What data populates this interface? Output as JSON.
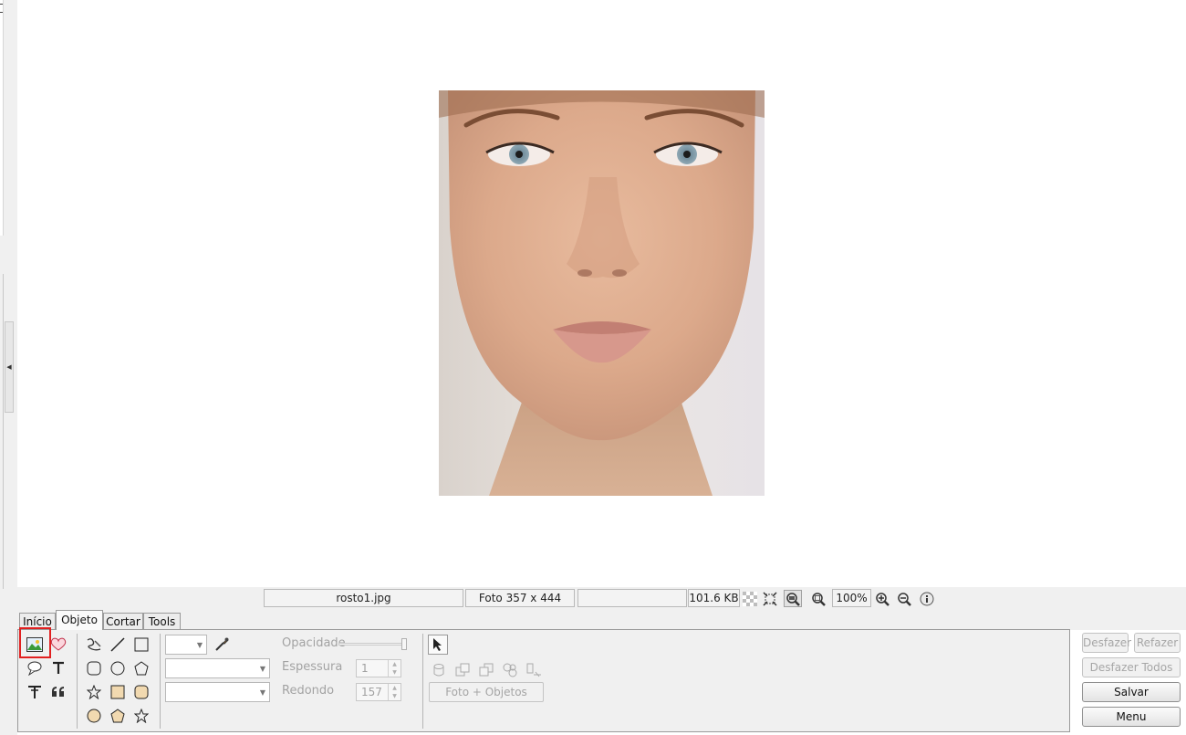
{
  "statusbar": {
    "filename": "rosto1.jpg",
    "photo_size": "Foto 357 x 444",
    "empty_field": "",
    "file_size": "101.6 KB",
    "zoom": "100%"
  },
  "tabs": [
    "Início",
    "Objeto",
    "Cortar",
    "Tools"
  ],
  "active_tab": "Objeto",
  "properties": {
    "opacity_label": "Opacidade",
    "thickness_label": "Espessura",
    "thickness_value": "1",
    "rounding_label": "Redondo",
    "rounding_value": "157",
    "opacity_level": 1.0
  },
  "object_tools": {
    "photo_objects_label": "Foto + Objetos"
  },
  "actions": {
    "undo": "Desfazer",
    "redo": "Refazer",
    "undo_all": "Desfazer Todos",
    "save": "Salvar",
    "menu": "Menu"
  },
  "colors": {
    "highlight": "#e12020",
    "background": "#f0f0f0"
  }
}
